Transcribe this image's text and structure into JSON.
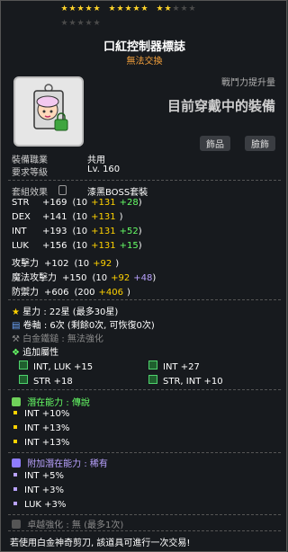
{
  "stars": {
    "filled": 12,
    "total": 20
  },
  "item": {
    "name": "口紅控制器標誌",
    "trade_status": "無法交換",
    "combat_label": "戰鬥力提升量",
    "combat_value": "目前穿戴中的裝備",
    "category_1": "飾品",
    "category_2": "臉飾"
  },
  "requirements": {
    "job_label": "裝備職業",
    "job_value": "共用",
    "level_label": "要求等級",
    "level_value": "Lv. 160"
  },
  "set": {
    "label": "套組效果",
    "value": "漆黑BOSS套裝"
  },
  "stats": [
    {
      "name": "STR",
      "total": "+169",
      "base": "(10",
      "bonus": "+131",
      "extra": "+28",
      "close": ")"
    },
    {
      "name": "DEX",
      "total": "+141",
      "base": "(10",
      "bonus": "+131",
      "extra": "",
      "close": ")"
    },
    {
      "name": "INT",
      "total": "+193",
      "base": "(10",
      "bonus": "+131",
      "extra": "+52",
      "close": ")"
    },
    {
      "name": "LUK",
      "total": "+156",
      "base": "(10",
      "bonus": "+131",
      "extra": "+15",
      "close": ")"
    },
    {
      "name": "攻擊力",
      "total": "+102",
      "base": "(10",
      "bonus": "+92",
      "extra": "",
      "close": ")"
    },
    {
      "name": "魔法攻擊力",
      "total": "+150",
      "base": "(10",
      "bonus": "+92",
      "extra": "+48",
      "close": ")"
    },
    {
      "name": "防禦力",
      "total": "+606",
      "base": "(200",
      "bonus": "+406",
      "extra": "",
      "close": ")"
    }
  ],
  "starforce": {
    "label": "星力",
    "value": ": 22星 (最多30星)"
  },
  "scroll": {
    "label": "卷軸",
    "value": ": 6次 (剩餘0次, 可恢復0次)"
  },
  "platinum": {
    "label": "白金鐵鎚",
    "value": ": 無法強化"
  },
  "additional": {
    "label": "追加屬性",
    "items": [
      "INT, LUK  +15",
      "INT  +27",
      "STR  +18",
      "STR, INT  +10"
    ]
  },
  "potential": {
    "label": "潛在能力",
    "grade": ": 傳說",
    "lines": [
      "INT +10%",
      "INT +13%",
      "INT +13%"
    ]
  },
  "bonus_potential": {
    "label": "附加潛在能力",
    "grade": ": 稀有",
    "lines": [
      "INT +5%",
      "INT +3%",
      "LUK +3%"
    ]
  },
  "transcend": {
    "label": "卓越強化",
    "value": ": 無 (最多1次)"
  },
  "footer": "若使用白金神奇剪刀, 該道具可進行一次交易!",
  "colors": {
    "legendary": "#66ff66",
    "unique": "#ffcc00",
    "rare": "#b9a2ff",
    "bonus": "#ffd200"
  }
}
